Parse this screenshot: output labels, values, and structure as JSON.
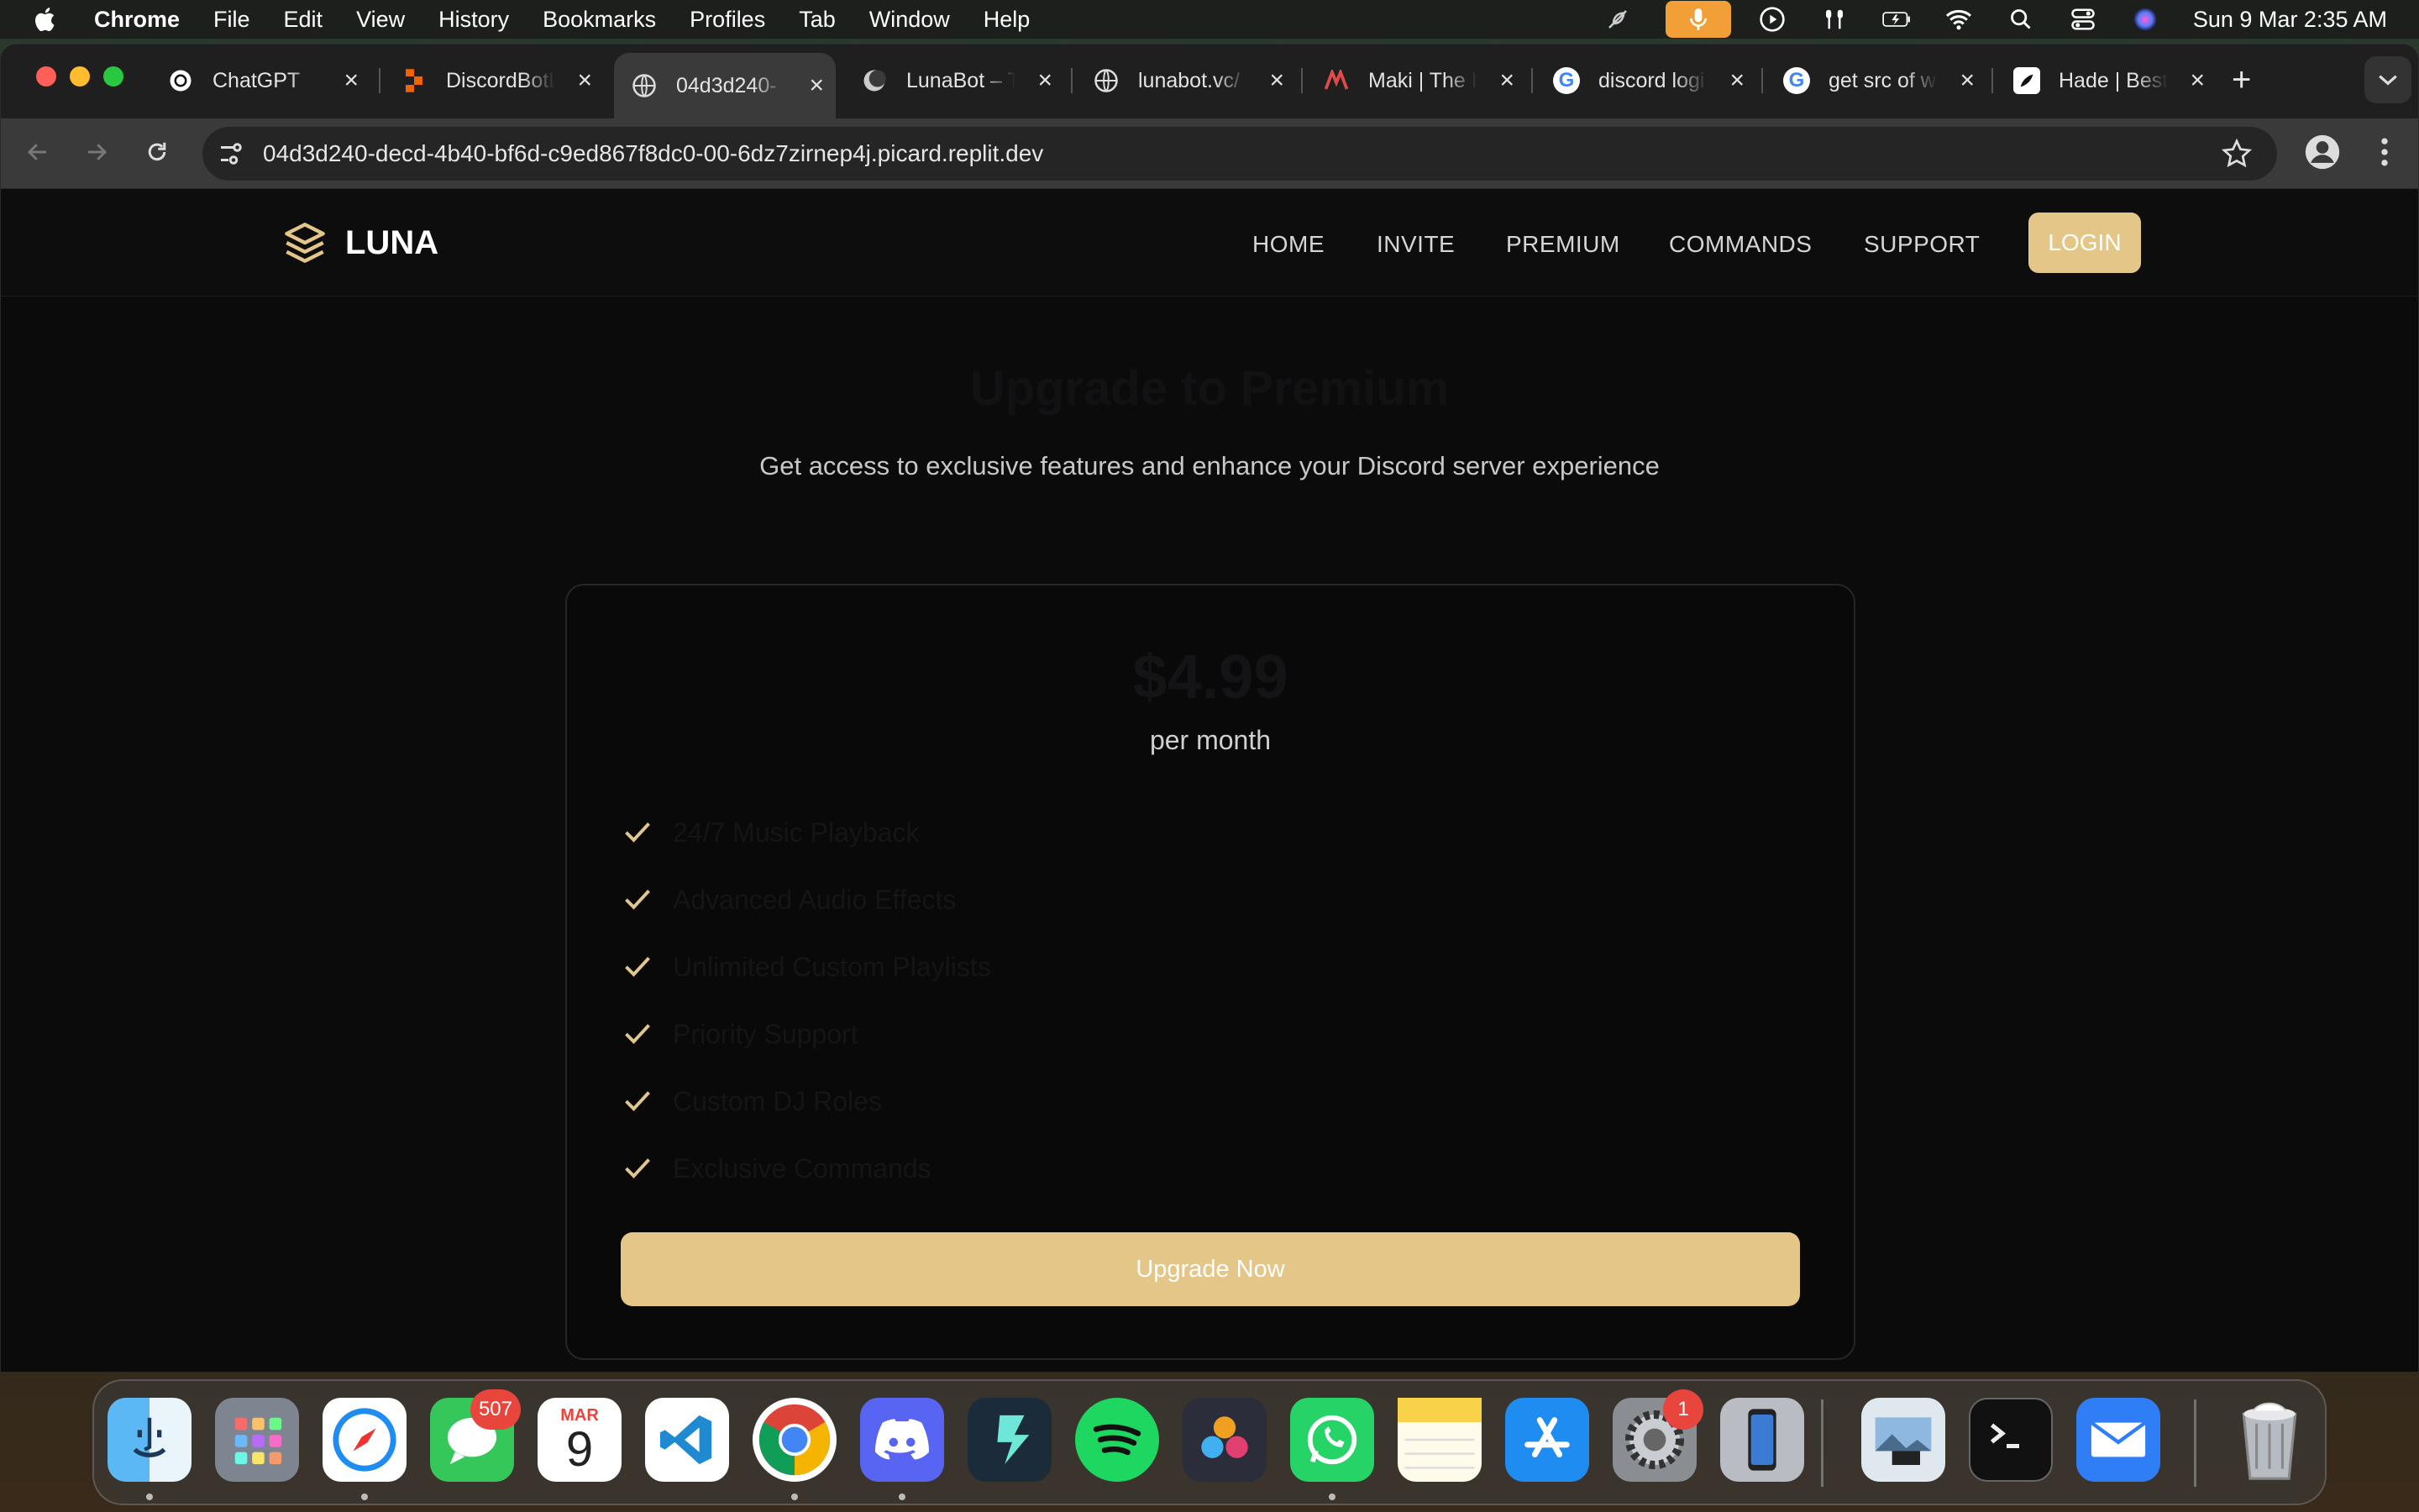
{
  "menubar": {
    "app_name": "Chrome",
    "items": [
      "File",
      "Edit",
      "View",
      "History",
      "Bookmarks",
      "Profiles",
      "Tab",
      "Window",
      "Help"
    ],
    "clock": "Sun 9 Mar  2:35 AM"
  },
  "browser": {
    "tabs": [
      {
        "title": "ChatGPT",
        "favicon": "chatgpt-icon"
      },
      {
        "title": "DiscordBotL",
        "favicon": "replit-icon"
      },
      {
        "title": "04d3d240-",
        "favicon": "globe-icon"
      },
      {
        "title": "LunaBot – T",
        "favicon": "luna-icon"
      },
      {
        "title": "lunabot.vc/",
        "favicon": "globe-icon"
      },
      {
        "title": "Maki | The I",
        "favicon": "maki-icon"
      },
      {
        "title": "discord logi",
        "favicon": "google-icon"
      },
      {
        "title": "get src of w",
        "favicon": "google-icon"
      },
      {
        "title": "Hade | Best",
        "favicon": "hade-icon"
      }
    ],
    "active_tab_index": 2,
    "url": "04d3d240-decd-4b40-bf6d-c9ed867f8dc0-00-6dz7zirnep4j.picard.replit.dev"
  },
  "site": {
    "logo_text": "LUNA",
    "nav": [
      "HOME",
      "INVITE",
      "PREMIUM",
      "COMMANDS",
      "SUPPORT"
    ],
    "login_label": "LOGIN",
    "hero_title": "Upgrade to Premium",
    "hero_subtitle": "Get access to exclusive features and enhance your Discord server experience",
    "plan": {
      "price": "$4.99",
      "period": "per month",
      "features": [
        "24/7 Music Playback",
        "Advanced Audio Effects",
        "Unlimited Custom Playlists",
        "Priority Support",
        "Custom DJ Roles",
        "Exclusive Commands"
      ],
      "cta": "Upgrade Now"
    },
    "colors": {
      "accent": "#e4c689",
      "background": "#0b0b0c"
    }
  },
  "dock": {
    "apps": [
      "Finder",
      "Launchpad",
      "Safari",
      "Messages",
      "Calendar",
      "Visual Studio Code",
      "Google Chrome",
      "Discord",
      "Filmora",
      "Spotify",
      "DaVinci Resolve",
      "WhatsApp",
      "Notes",
      "App Store",
      "System Settings",
      "iPhone Mirroring",
      "Preview",
      "Terminal",
      "Mail",
      "Trash"
    ],
    "messages_badge": "507",
    "settings_badge": "1",
    "calendar_month": "MAR",
    "calendar_day": "9"
  }
}
